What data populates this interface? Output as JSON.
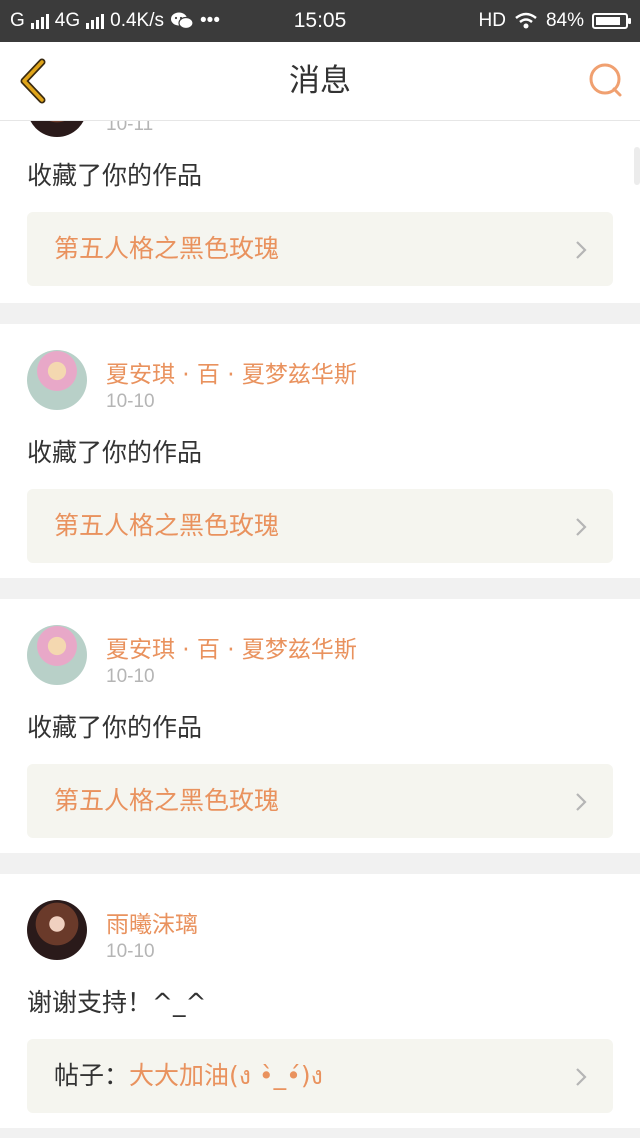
{
  "status_bar": {
    "carrier": "G",
    "network": "4G",
    "speed": "0.4K/s",
    "more": "•••",
    "time": "15:05",
    "hd": "HD",
    "battery": "84%",
    "battery_level": 0.84
  },
  "nav": {
    "title": "消息"
  },
  "messages": [
    {
      "date": "10-11",
      "text": "收藏了你的作品",
      "link": "第五人格之黑色玫瑰"
    },
    {
      "user": "夏安琪 · 百 · 夏梦兹华斯",
      "date": "10-10",
      "text": "收藏了你的作品",
      "link": "第五人格之黑色玫瑰"
    },
    {
      "user": "夏安琪 · 百 · 夏梦兹华斯",
      "date": "10-10",
      "text": "收藏了你的作品",
      "link": "第五人格之黑色玫瑰"
    },
    {
      "user": "雨曦沫璃",
      "date": "10-10",
      "text": "谢谢支持！^_^",
      "link_prefix": "帖子：",
      "link": "大大加油(ง •̀_•́)ง"
    }
  ],
  "colors": {
    "accent": "#e9925e",
    "status_bar": "#3b3b3b",
    "back_icon": "#e0a51a"
  },
  "icons": [
    "back-arrow-icon",
    "search-icon",
    "chevron-right-icon",
    "wechat-icon",
    "wifi-icon",
    "battery-icon"
  ]
}
